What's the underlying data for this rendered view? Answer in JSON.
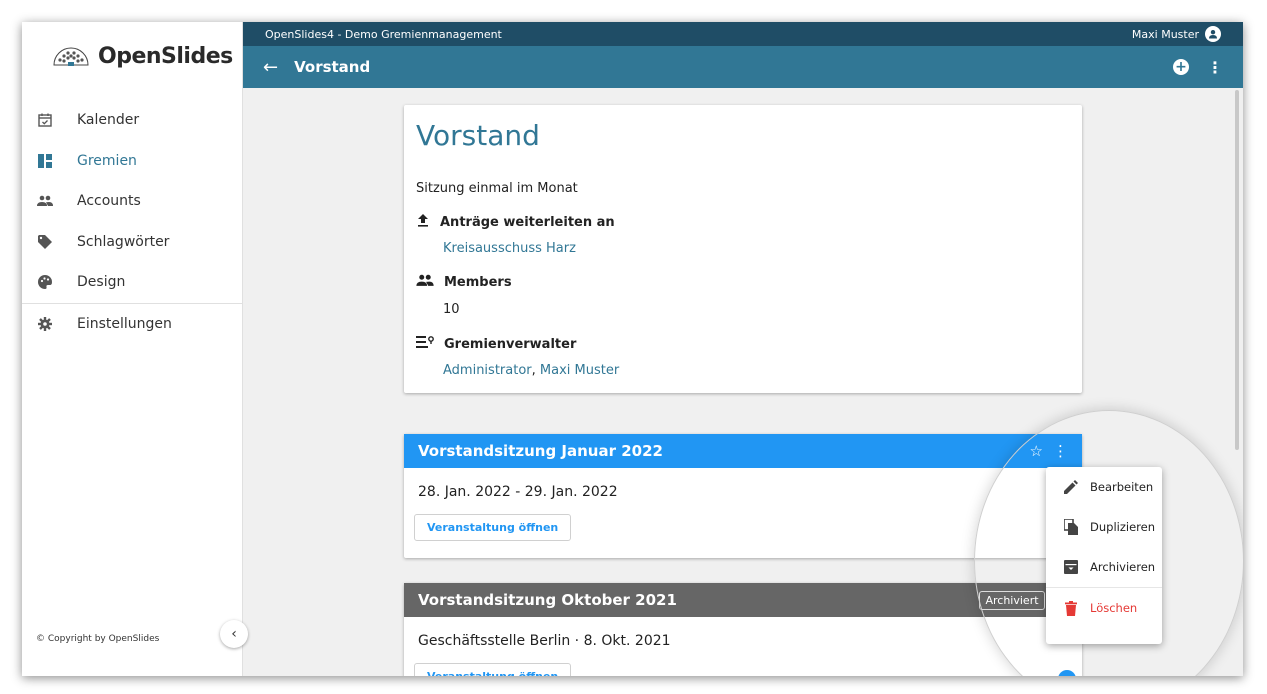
{
  "app": {
    "logo_text": "OpenSlides",
    "topbar_title": "OpenSlides4 - Demo Gremienmanagement",
    "user_name": "Maxi Muster",
    "copyright": "© Copyright by OpenSlides"
  },
  "sidebar": {
    "items": [
      {
        "label": "Kalender",
        "icon": "calendar-icon"
      },
      {
        "label": "Gremien",
        "icon": "dashboard-icon",
        "active": true
      },
      {
        "label": "Accounts",
        "icon": "people-icon"
      },
      {
        "label": "Schlagwörter",
        "icon": "tag-icon"
      },
      {
        "label": "Design",
        "icon": "palette-icon"
      },
      {
        "label": "Einstellungen",
        "icon": "gear-icon"
      }
    ]
  },
  "header": {
    "title": "Vorstand"
  },
  "committee": {
    "name": "Vorstand",
    "description": "Sitzung einmal im Monat",
    "forward_heading": "Anträge weiterleiten an",
    "forward_value": "Kreisausschuss Harz",
    "members_heading": "Members",
    "members_count": "10",
    "managers_heading": "Gremienverwalter",
    "manager_1": "Administrator",
    "manager_sep": ", ",
    "manager_2": "Maxi Muster"
  },
  "meetings": [
    {
      "title": "Vorstandsitzung Januar 2022",
      "date": "28. Jan. 2022 - 29. Jan. 2022",
      "button": "Veranstaltung öffnen"
    },
    {
      "title": "Vorstandsitzung Oktober 2021",
      "archived_badge": "Archiviert",
      "date": "Geschäftsstelle Berlin · 8. Okt. 2021",
      "button": "Veranstaltung öffnen"
    }
  ],
  "context_menu": {
    "items": [
      {
        "label": "Bearbeiten",
        "icon": "pencil-icon"
      },
      {
        "label": "Duplizieren",
        "icon": "copy-icon"
      },
      {
        "label": "Archivieren",
        "icon": "archive-icon"
      },
      {
        "label": "Löschen",
        "icon": "trash-icon"
      }
    ]
  },
  "colors": {
    "primary": "#317795",
    "topbar": "#1f4d66",
    "accent": "#2196f3",
    "archived_header": "#666666",
    "danger": "#e53935"
  }
}
